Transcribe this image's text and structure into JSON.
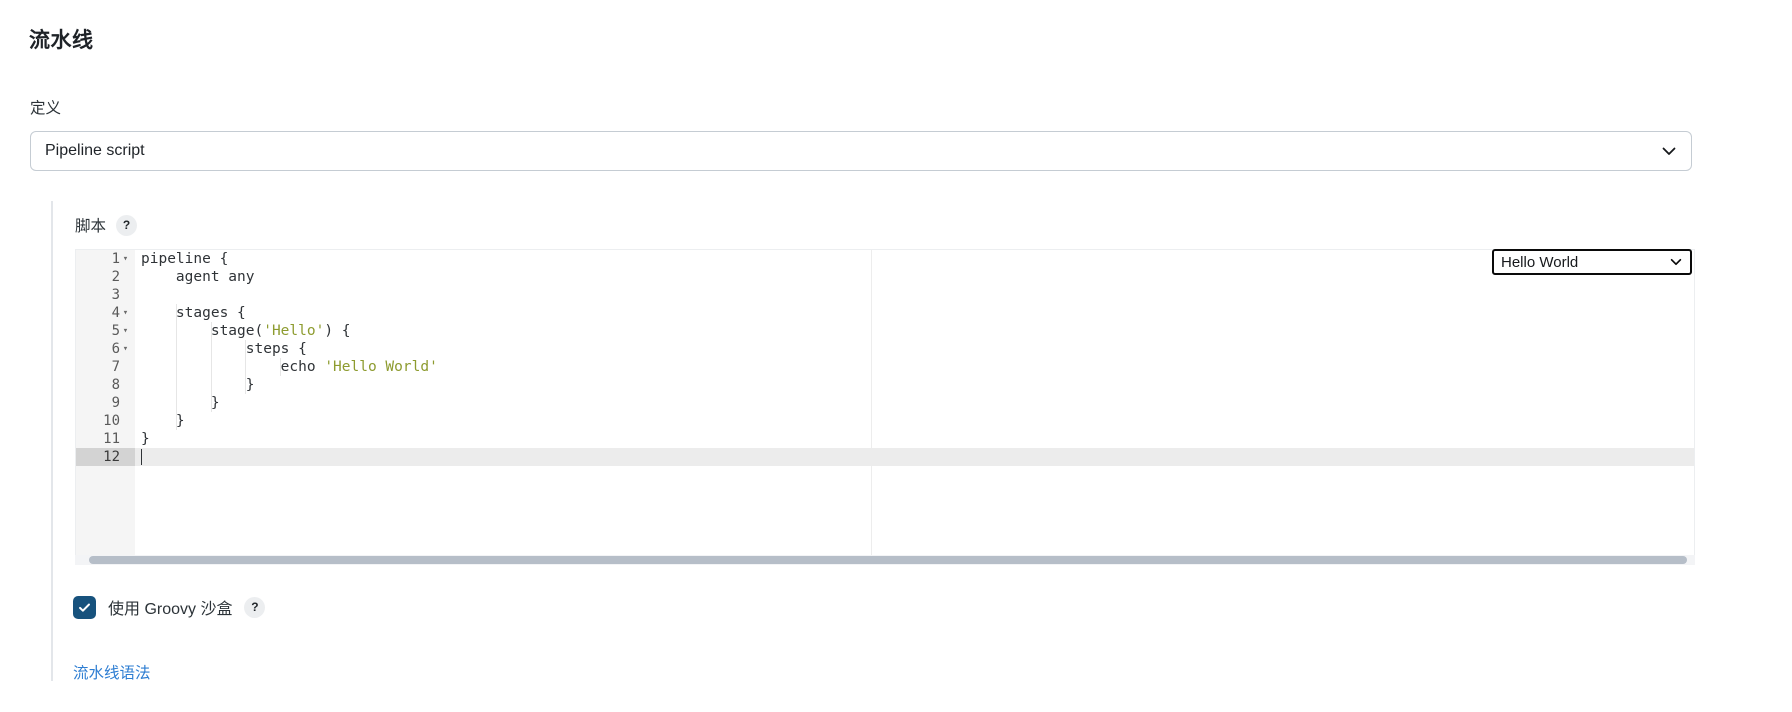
{
  "section": {
    "title": "流水线"
  },
  "definition": {
    "label": "定义",
    "selected": "Pipeline script",
    "chevron_icon": "chevron-down-icon",
    "options": [
      "Pipeline script"
    ]
  },
  "script": {
    "label": "脚本",
    "help_badge": "?",
    "sample_select": {
      "selected": "Hello World",
      "chevron_icon": "chevron-down-icon",
      "options": [
        "Hello World"
      ]
    },
    "editor": {
      "active_line": 12,
      "gutter": [
        {
          "num": "1",
          "fold": "▾"
        },
        {
          "num": "2",
          "fold": ""
        },
        {
          "num": "3",
          "fold": ""
        },
        {
          "num": "4",
          "fold": "▾"
        },
        {
          "num": "5",
          "fold": "▾"
        },
        {
          "num": "6",
          "fold": "▾"
        },
        {
          "num": "7",
          "fold": ""
        },
        {
          "num": "8",
          "fold": ""
        },
        {
          "num": "9",
          "fold": ""
        },
        {
          "num": "10",
          "fold": ""
        },
        {
          "num": "11",
          "fold": ""
        },
        {
          "num": "12",
          "fold": ""
        }
      ],
      "lines": [
        "pipeline {",
        "    agent any",
        "",
        "    stages {",
        "        stage('Hello') {",
        "            steps {",
        "                echo 'Hello World'",
        "            }",
        "        }",
        "    }",
        "}",
        ""
      ],
      "string_color": "#8d9b2f",
      "text_color": "#2f3337",
      "gutter_bg": "#f5f5f5",
      "active_line_bg": "#ececec"
    }
  },
  "sandbox": {
    "label": "使用 Groovy 沙盒",
    "checked": true,
    "check_icon": "checkmark-icon",
    "help_badge": "?",
    "accent_color": "#17527d"
  },
  "footer": {
    "syntax_link": "流水线语法",
    "link_color": "#2d7dd2"
  }
}
